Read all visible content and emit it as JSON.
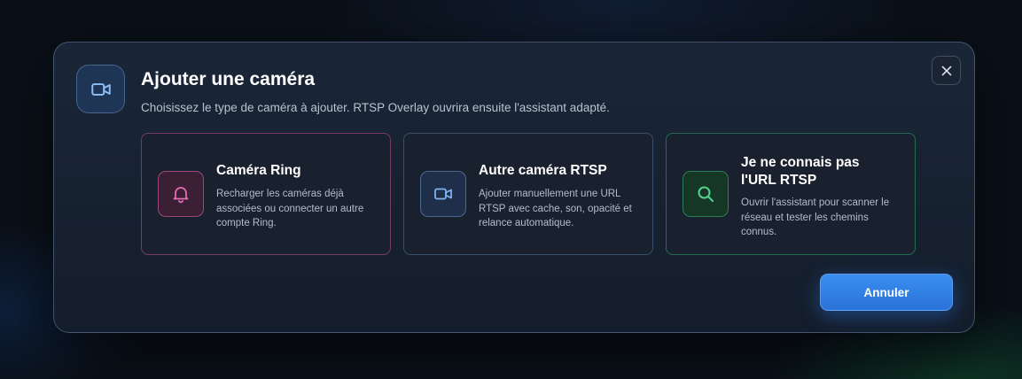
{
  "dialog": {
    "title": "Ajouter une caméra",
    "subtitle": "Choisissez le type de caméra à ajouter. RTSP Overlay ouvrira ensuite l'assistant adapté.",
    "header_icon": "video-camera-icon",
    "close_icon": "close-icon"
  },
  "options": [
    {
      "title": "Caméra Ring",
      "description": "Recharger les caméras déjà associées ou connecter un autre compte Ring.",
      "icon": "bell-icon",
      "accent": "#e46bb3"
    },
    {
      "title": "Autre caméra RTSP",
      "description": "Ajouter manuellement une URL RTSP avec cache, son, opacité et relance automatique.",
      "icon": "video-camera-icon",
      "accent": "#7fb2f0"
    },
    {
      "title": "Je ne connais pas l'URL RTSP",
      "description": "Ouvrir l'assistant pour scanner le réseau et tester les chemins connus.",
      "icon": "search-icon",
      "accent": "#4fd58e"
    }
  ],
  "actions": {
    "cancel_label": "Annuler"
  },
  "colors": {
    "primary": "#2f80e8",
    "background": "#0a1018",
    "dialog": "#172233"
  }
}
